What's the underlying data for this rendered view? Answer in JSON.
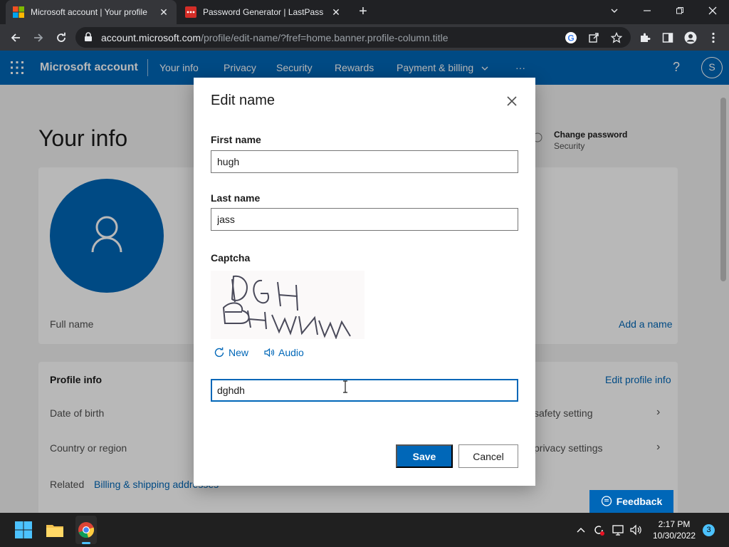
{
  "browser": {
    "tabs": [
      {
        "title": "Microsoft account | Your profile",
        "active": true,
        "icon": "microsoft-logo-icon"
      },
      {
        "title": "Password Generator | LastPass",
        "active": false,
        "icon": "lastpass-icon"
      }
    ],
    "address": {
      "domain": "account.microsoft.com",
      "path": "/profile/edit-name/?fref=home.banner.profile-column.title"
    }
  },
  "header": {
    "brand": "Microsoft account",
    "nav": [
      "Your info",
      "Privacy",
      "Security",
      "Rewards",
      "Payment & billing",
      "···"
    ],
    "help": "?",
    "avatar_letter": "S"
  },
  "page": {
    "title": "Your info",
    "change_password": {
      "title": "Change password",
      "subtitle": "Security"
    },
    "full_name_label": "Full name",
    "add_name_link": "Add a name",
    "profile_info": {
      "title": "Profile info",
      "edit_link": "Edit profile info",
      "rows": [
        "Date of birth",
        "Country or region"
      ],
      "right_rows": [
        "safety setting",
        "privacy settings"
      ],
      "related_label": "Related",
      "related_link": "Billing & shipping addresses"
    },
    "feedback": "Feedback"
  },
  "modal": {
    "title": "Edit name",
    "first_name": {
      "label": "First name",
      "value": "hugh"
    },
    "last_name": {
      "label": "Last name",
      "value": "jass"
    },
    "captcha": {
      "label": "Captcha",
      "image_text": "DGH BHWN",
      "new": "New",
      "audio": "Audio",
      "value": "dghdh"
    },
    "save": "Save",
    "cancel": "Cancel"
  },
  "taskbar": {
    "time": "2:17 PM",
    "date": "10/30/2022",
    "notifications": "3"
  },
  "colors": {
    "accent": "#0067b8",
    "chrome_dark": "#202124",
    "chrome_toolbar": "#35363a"
  }
}
